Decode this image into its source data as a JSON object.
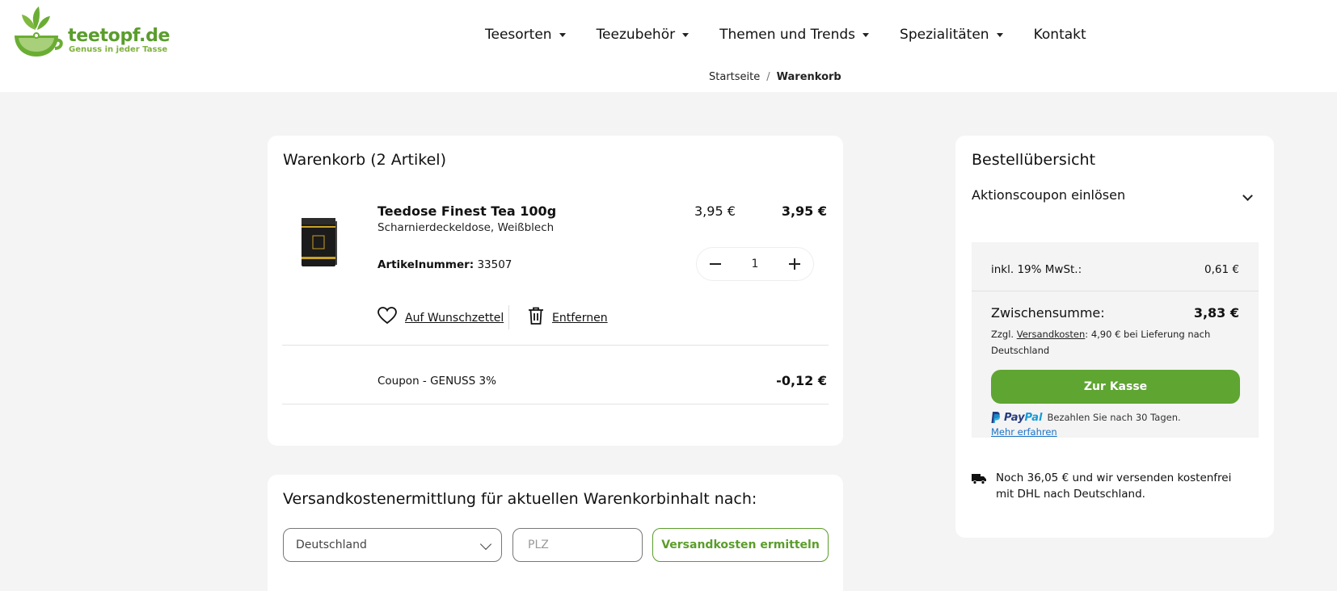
{
  "header": {
    "logo_name": "teetopf.de",
    "logo_tagline": "Genuss in jeder Tasse",
    "nav": [
      {
        "label": "Teesorten",
        "dropdown": true
      },
      {
        "label": "Teezubehör",
        "dropdown": true
      },
      {
        "label": "Themen und Trends",
        "dropdown": true
      },
      {
        "label": "Spezialitäten",
        "dropdown": true
      },
      {
        "label": "Kontakt",
        "dropdown": false
      }
    ]
  },
  "breadcrumb": {
    "home": "Startseite",
    "separator": "/",
    "current": "Warenkorb"
  },
  "cart": {
    "title": "Warenkorb (2 Artikel)",
    "item": {
      "name": "Teedose Finest Tea 100g",
      "subtitle": "Scharnierdeckeldose, Weißblech",
      "unit_price": "3,95 €",
      "total_price": "3,95 €",
      "sku_label": "Artikelnummer:",
      "sku_value": "33507",
      "quantity": "1",
      "wishlist_label": "Auf Wunschzettel",
      "remove_label": "Entfernen"
    },
    "coupon": {
      "label": "Coupon - GENUSS 3%",
      "value": "-0,12 €"
    }
  },
  "shipping_calc": {
    "title": "Versandkostenermittlung für aktuellen Warenkorbinhalt nach:",
    "country": "Deutschland",
    "zip_placeholder": "PLZ",
    "button_label": "Versandkosten ermitteln"
  },
  "summary": {
    "title": "Bestellübersicht",
    "coupon_toggle": "Aktionscoupon einlösen",
    "vat_label": "inkl. 19% MwSt.:",
    "vat_value": "0,61 €",
    "subtotal_label": "Zwischensumme:",
    "subtotal_value": "3,83 €",
    "shipping_prefix": "Zzgl.",
    "shipping_link": "Versandkosten",
    "shipping_suffix": ": 4,90 € bei Lieferung nach Deutschland",
    "checkout_label": "Zur Kasse",
    "paypal_word_1": "Pay",
    "paypal_word_2": "Pal",
    "paypal_text": "Bezahlen Sie nach 30 Tagen.",
    "paypal_more": "Mehr erfahren",
    "free_shipping_text": "Noch 36,05 € und wir versenden kostenfrei mit DHL nach Deutschland."
  },
  "colors": {
    "brand_green": "#5fa532",
    "link_blue": "#1a73c7",
    "page_bg": "#f4f4f4"
  },
  "icons": {
    "logo": "teapot-leaf-icon",
    "wishlist": "heart-icon",
    "remove": "trash-icon",
    "coupon_toggle": "chevron-down-icon",
    "country_select": "chevron-down-icon",
    "paypal": "paypal-icon",
    "free_shipping": "truck-icon"
  }
}
